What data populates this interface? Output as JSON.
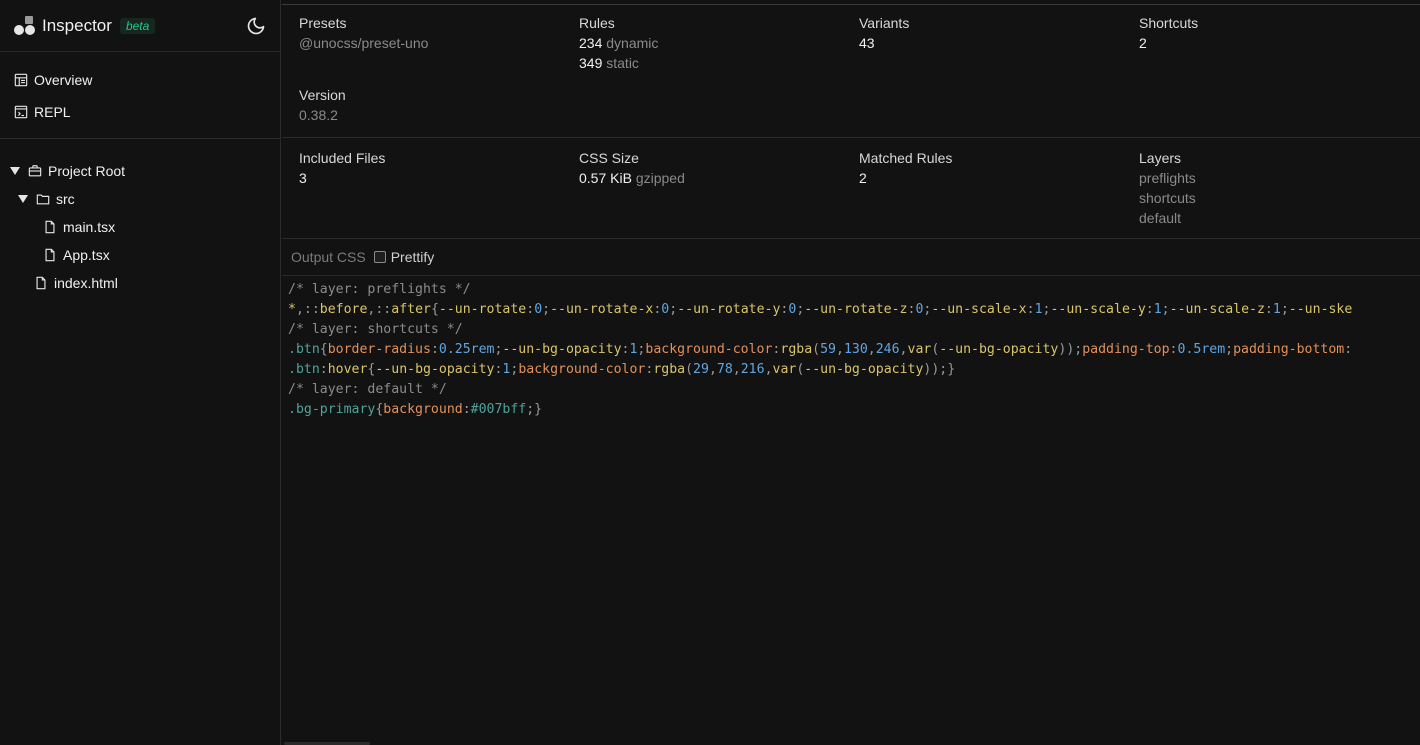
{
  "sidebar": {
    "brand_title": "Inspector",
    "brand_badge": "beta",
    "nav": [
      {
        "label": "Overview",
        "icon": "overview-icon"
      },
      {
        "label": "REPL",
        "icon": "repl-icon"
      }
    ],
    "tree": {
      "root": "Project Root",
      "src": "src",
      "files_src": [
        "main.tsx",
        "App.tsx"
      ],
      "root_file": "index.html"
    }
  },
  "stats": {
    "presets": {
      "label": "Presets",
      "value": "@unocss/preset-uno"
    },
    "rules": {
      "label": "Rules",
      "dynamic_count": "234",
      "dynamic_label": "dynamic",
      "static_count": "349",
      "static_label": "static"
    },
    "variants": {
      "label": "Variants",
      "value": "43"
    },
    "shortcuts": {
      "label": "Shortcuts",
      "value": "2"
    },
    "version": {
      "label": "Version",
      "value": "0.38.2"
    },
    "included_files": {
      "label": "Included Files",
      "value": "3"
    },
    "css_size": {
      "label": "CSS Size",
      "value": "0.57 KiB",
      "suffix": "gzipped"
    },
    "matched_rules": {
      "label": "Matched Rules",
      "value": "2"
    },
    "layers": {
      "label": "Layers",
      "items": [
        "preflights",
        "shortcuts",
        "default"
      ]
    }
  },
  "output": {
    "label": "Output CSS",
    "prettify_label": "Prettify",
    "prettify_checked": false
  },
  "code": {
    "comment_preflights": "/* layer: preflights */",
    "comment_shortcuts": "/* layer: shortcuts */",
    "comment_default": "/* layer: default */"
  },
  "colors": {
    "background": "#121212",
    "accent": "#22c38e"
  }
}
